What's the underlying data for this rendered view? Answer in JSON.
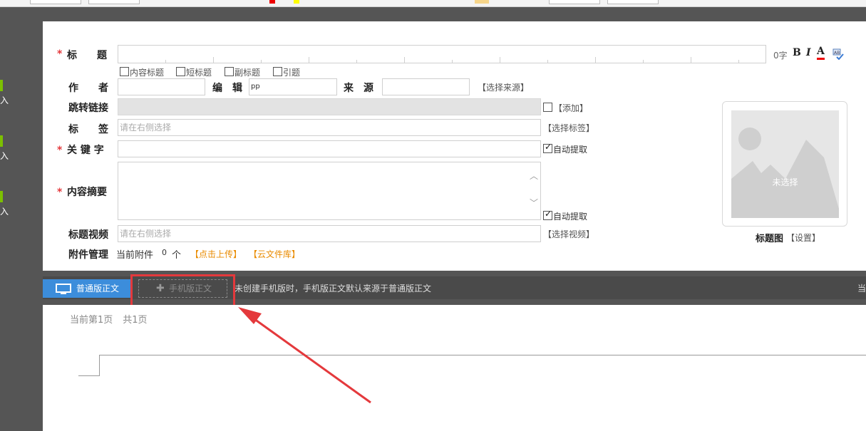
{
  "sidebar": {
    "items": [
      {
        "label": "入"
      },
      {
        "label": "入"
      },
      {
        "label": "入"
      }
    ]
  },
  "form": {
    "title_label": "标　　题",
    "title_count": "0字",
    "format_bold": "B",
    "format_italic": "I",
    "format_color": "A",
    "options": [
      "内容标题",
      "短标题",
      "副标题",
      "引题"
    ],
    "author_label": "作　　者",
    "editor_label": "编　辑",
    "editor_value": "pp",
    "source_label": "来　源",
    "select_source": "【选择来源】",
    "redirect_label": "跳转链接",
    "add_link": "【添加】",
    "tag_label": "标　　签",
    "tag_placeholder": "请在右侧选择",
    "select_tag": "【选择标签】",
    "keyword_label": "关 键 字",
    "auto_extract": "自动提取",
    "summary_label": "内容摘要",
    "auto_extract2": "自动提取",
    "video_label": "标题视频",
    "video_placeholder": "请在右侧选择",
    "select_video": "【选择视频】",
    "attachment_label": "附件管理",
    "current_attachment": "当前附件",
    "attachment_count": "0",
    "attachment_unit": "个",
    "upload": "【点击上传】",
    "cloud_lib": "【云文件库】",
    "image_placeholder": "未选择",
    "title_image_label": "标题图",
    "image_settings": "【设置】"
  },
  "tabs": {
    "normal": "普通版正文",
    "mobile": "手机版正文",
    "hint": "未创建手机版时，手机版正文默认来源于普通版正文",
    "right_text": "当"
  },
  "editor": {
    "current_page": "当前第1页",
    "total_pages": "共1页"
  },
  "colors": {
    "accent_blue": "#3c8ddb",
    "required_red": "#e4393c",
    "link_orange": "#e98b00",
    "sidebar_green": "#7cc000"
  }
}
